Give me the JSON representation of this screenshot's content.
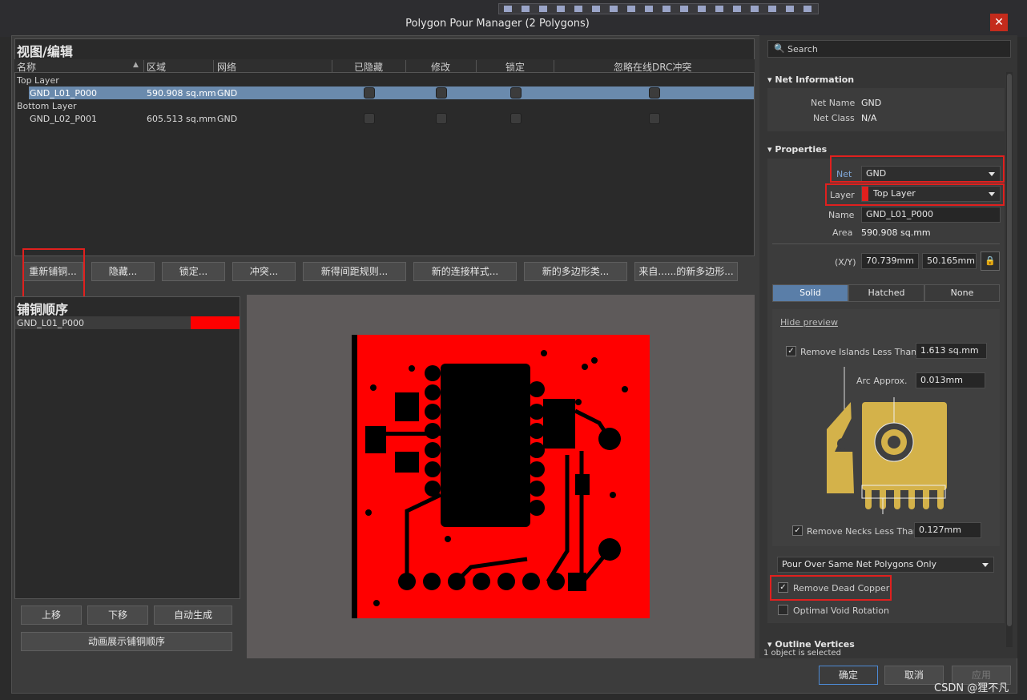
{
  "window": {
    "title": "Polygon Pour Manager (2 Polygons)",
    "close": "✕"
  },
  "view_edit": {
    "heading": "视图/编辑",
    "columns": [
      "名称",
      "区域",
      "网络",
      "已隐藏",
      "修改",
      "锁定",
      "忽略在线DRC冲突"
    ],
    "groups": [
      {
        "label": "Top Layer",
        "rows": [
          {
            "name": "GND_L01_P000",
            "area": "590.908 sq.mm",
            "net": "GND",
            "selected": true
          }
        ]
      },
      {
        "label": "Bottom Layer",
        "rows": [
          {
            "name": "GND_L02_P001",
            "area": "605.513 sq.mm",
            "net": "GND",
            "selected": false
          }
        ]
      }
    ],
    "buttons": [
      "重新铺铜...",
      "隐藏...",
      "锁定...",
      "冲突...",
      "新得间距规则...",
      "新的连接样式...",
      "新的多边形类...",
      "来自......的新多边形..."
    ]
  },
  "pour_order": {
    "heading": "铺铜顺序",
    "items": [
      {
        "name": "GND_L01_P000",
        "color": "#ff0000"
      }
    ],
    "buttons": {
      "up": "上移",
      "down": "下移",
      "auto": "自动生成",
      "animate": "动画展示铺铜顺序"
    }
  },
  "right_panel": {
    "search_placeholder": "Search",
    "net_info": {
      "title": "Net Information",
      "net_name_label": "Net Name",
      "net_name": "GND",
      "net_class_label": "Net Class",
      "net_class": "N/A"
    },
    "properties": {
      "title": "Properties",
      "net_label": "Net",
      "net_value": "GND",
      "layer_label": "Layer",
      "layer_value": "Top Layer",
      "layer_color": "#e0201e",
      "name_label": "Name",
      "name_value": "GND_L01_P000",
      "area_label": "Area",
      "area_value": "590.908 sq.mm",
      "xy_label": "(X/Y)",
      "x_value": "70.739mm",
      "y_value": "50.165mm",
      "fill_modes": [
        "Solid",
        "Hatched",
        "None"
      ],
      "hide_preview": "Hide preview",
      "remove_islands_label": "Remove Islands Less Than",
      "remove_islands_value": "1.613 sq.mm",
      "arc_label": "Arc Approx.",
      "arc_value": "0.013mm",
      "remove_necks_label": "Remove Necks Less Than",
      "remove_necks_value": "0.127mm",
      "pour_over": "Pour Over Same Net Polygons Only",
      "remove_dead_copper": "Remove Dead Copper",
      "optimal_void": "Optimal Void Rotation"
    },
    "outline": {
      "title": "Outline Vertices",
      "status": "1 object is selected"
    }
  },
  "footer": {
    "ok": "确定",
    "cancel": "取消",
    "apply": "应用"
  },
  "watermark": "CSDN @狸不凡"
}
